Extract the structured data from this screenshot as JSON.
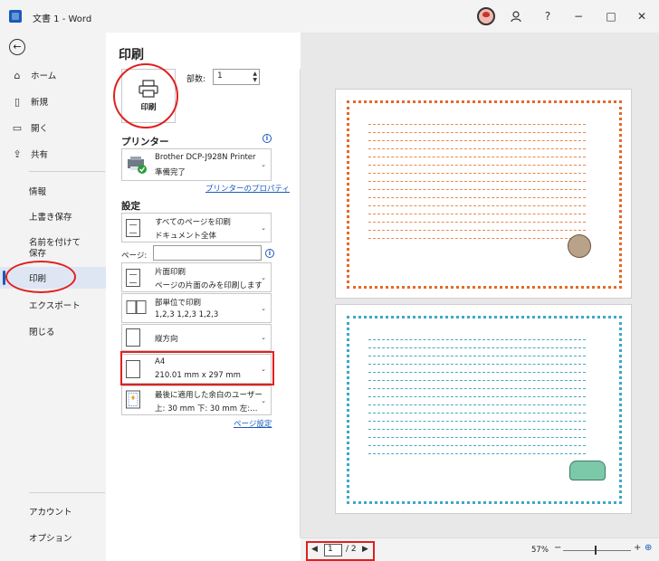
{
  "app": {
    "window_title": "文書 1 - Word"
  },
  "titlebar": {
    "help_label": "?",
    "minimize_label": "−",
    "maximize_label": "□",
    "close_label": "✕"
  },
  "nav": {
    "items": [
      {
        "label": "ホーム",
        "icon": "home-icon"
      },
      {
        "label": "新規",
        "icon": "new-document-icon"
      },
      {
        "label": "開く",
        "icon": "folder-open-icon"
      },
      {
        "label": "共有",
        "icon": "share-icon"
      },
      {
        "label": "情報"
      },
      {
        "label": "上書き保存"
      },
      {
        "label": "名前を付けて保存"
      },
      {
        "label": "印刷",
        "selected": true
      },
      {
        "label": "エクスポート"
      },
      {
        "label": "閉じる"
      }
    ],
    "bottom_items": [
      {
        "label": "アカウント"
      },
      {
        "label": "オプション"
      }
    ]
  },
  "print": {
    "title": "印刷",
    "print_button_label": "印刷",
    "copies_label": "部数:",
    "copies_value": "1",
    "printer_heading": "プリンター",
    "printer_name": "Brother DCP-J928N Printer",
    "printer_status": "準備完了",
    "printer_properties_link": "プリンターのプロパティ",
    "settings_heading": "設定",
    "pages_label": "ページ:",
    "pages_value": "",
    "page_setup_link": "ページ設定",
    "settings": [
      {
        "line1": "すべてのページを印刷",
        "line2": "ドキュメント全体",
        "icon": "document-icon"
      },
      {
        "line1": "片面印刷",
        "line2": "ページの片面のみを印刷します",
        "icon": "one-sided-icon"
      },
      {
        "line1": "部単位で印刷",
        "line2": "1,2,3    1,2,3    1,2,3",
        "icon": "collate-icon"
      },
      {
        "line1": "縦方向",
        "line2": "",
        "icon": "portrait-icon"
      },
      {
        "line1": "A4",
        "line2": "210.01 mm x 297 mm",
        "icon": "paper-size-icon"
      },
      {
        "line1": "最後に適用した余白のユーザー…",
        "line2": "上: 30 mm 下: 30 mm 左:…",
        "icon": "margins-icon"
      }
    ]
  },
  "preview": {
    "current_page": "1",
    "total_pages": "/ 2",
    "zoom_percent": "57%"
  },
  "colors": {
    "accent": "#185abd",
    "highlight_red": "#e02020",
    "border_orange": "#e36a2a",
    "border_blue": "#3fa7c9"
  }
}
